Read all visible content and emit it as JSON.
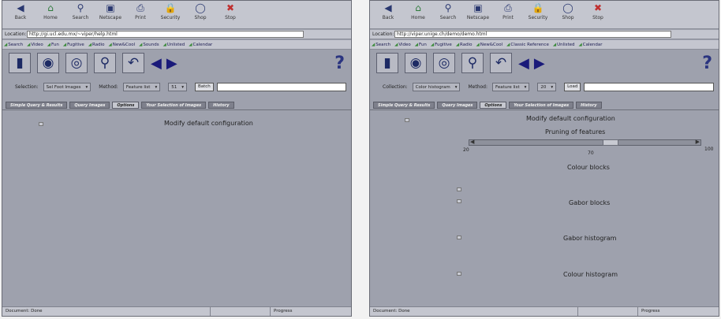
{
  "nav": {
    "back": "Back",
    "home": "Home",
    "search": "Search",
    "netscape": "Netscape",
    "print": "Print",
    "security": "Security",
    "shop": "Shop",
    "stop": "Stop"
  },
  "location": {
    "label": "Location:"
  },
  "left": {
    "url": "http://gi.ucl.edu.mx/~viper/help.html",
    "bookmarks": [
      "Search",
      "Video",
      "Fun",
      "Fugitive",
      "Radio",
      "New&Cool",
      "Sounds",
      "Unlisted",
      "Calendar"
    ],
    "selector1": {
      "label": "Selection:",
      "value": "Sel Foot Images"
    },
    "selector2": {
      "label": "Method:",
      "value": "Feature list"
    },
    "selector3": {
      "value": "51"
    },
    "edit_button": "Batch",
    "input_value": "",
    "tabs": [
      "Simple Query & Results",
      "Query Images",
      "Options",
      "Your Selection of Images",
      "History"
    ],
    "option": "Modify default configuration",
    "status_msg": "Document: Done",
    "status_prog": "Progress"
  },
  "right": {
    "url": "http://viper.unige.ch/demo/demo.html",
    "bookmarks": [
      "Search",
      "Video",
      "Fun",
      "Fugitive",
      "Radio",
      "New&Cool",
      "Classic Reference",
      "Unlisted",
      "Calendar"
    ],
    "selector1": {
      "label": "Collection:",
      "value": "Color histogram"
    },
    "selector2": {
      "label": "Method:",
      "value": "Feature list"
    },
    "selector3": {
      "value": "20"
    },
    "edit_button": "Load",
    "input_value": "",
    "tabs": [
      "Simple Query & Results",
      "Query Images",
      "Options",
      "Your Selection of Images",
      "History"
    ],
    "option": "Modify default configuration",
    "slider_title": "Pruning of features",
    "slider_min": "20",
    "slider_value": "70",
    "slider_max": "100",
    "opt1": "Colour blocks",
    "opt2": "Gabor blocks",
    "opt3": "Gabor histogram",
    "opt4": "Colour histogram",
    "status_msg": "Document: Done",
    "status_prog": "Progress"
  }
}
